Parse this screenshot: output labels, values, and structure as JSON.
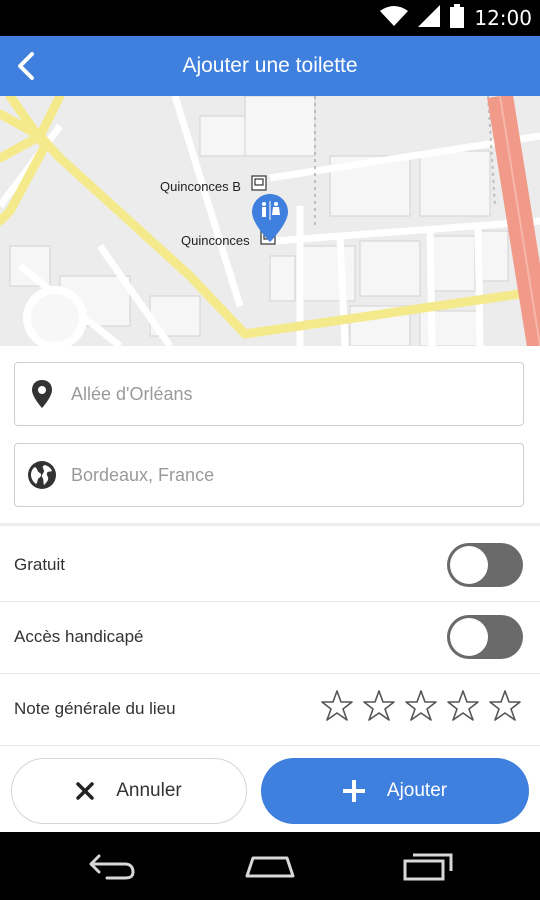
{
  "status_bar": {
    "time": "12:00"
  },
  "app_bar": {
    "title": "Ajouter une toilette"
  },
  "map": {
    "labels": [
      "Quinconces B",
      "Quinconces"
    ],
    "marker": "toilet-marker"
  },
  "form": {
    "address": {
      "placeholder": "Allée d'Orléans",
      "icon": "location-pin-icon"
    },
    "city": {
      "placeholder": "Bordeaux, France",
      "icon": "globe-icon"
    }
  },
  "options": {
    "free": {
      "label": "Gratuit",
      "enabled": false
    },
    "handicap": {
      "label": "Accès handicapé",
      "enabled": false
    },
    "rating": {
      "label": "Note générale du lieu",
      "stars_total": 5,
      "value": 0
    }
  },
  "actions": {
    "cancel_label": "Annuler",
    "add_label": "Ajouter"
  },
  "colors": {
    "primary": "#3f7fde",
    "road_yellow": "#f5ea8b",
    "road_red": "#f29a8a",
    "toggle_off": "#6a6a6a"
  }
}
